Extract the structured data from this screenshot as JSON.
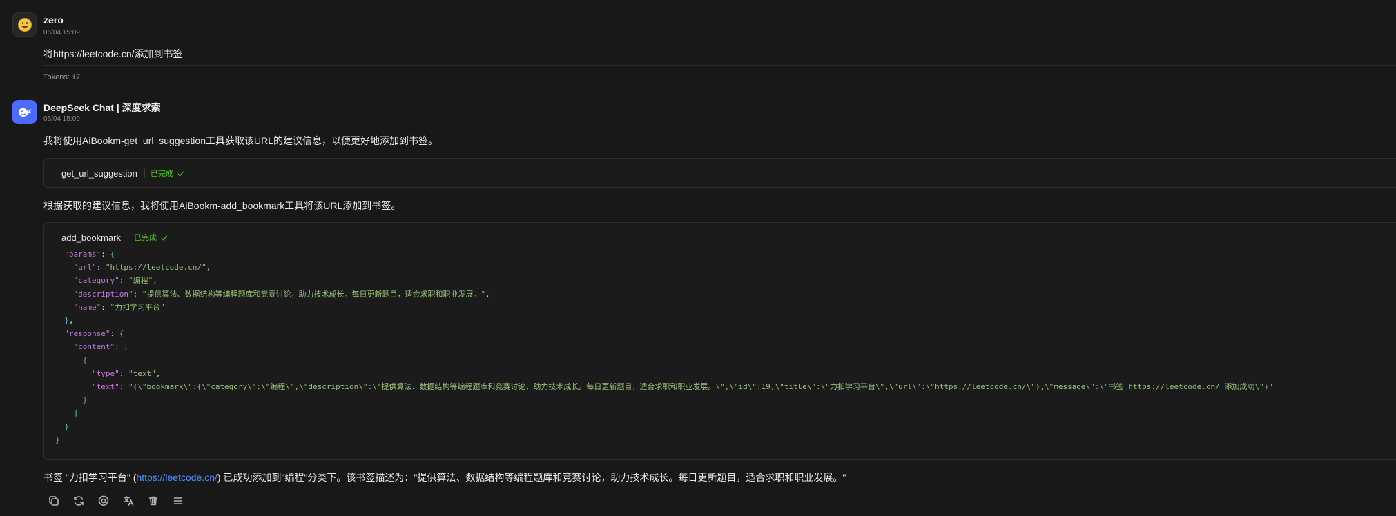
{
  "user_message": {
    "name": "zero",
    "time": "06/04 15:09",
    "text": "将https://leetcode.cn/添加到书签",
    "tokens": "Tokens: 17"
  },
  "bot_message": {
    "name": "DeepSeek Chat | 深度求索",
    "time": "06/04 15:09",
    "intro": "我将使用AiBookm-get_url_suggestion工具获取该URL的建议信息，以便更好地添加到书签。",
    "tool1": {
      "name": "get_url_suggestion",
      "status": "已完成"
    },
    "middle": "根据获取的建议信息，我将使用AiBookm-add_bookmark工具将该URL添加到书签。",
    "tool2": {
      "name": "add_bookmark",
      "status": "已完成",
      "url": "https://leetcode.cn/",
      "category": "编程",
      "description": "提供算法、数据结构等编程题库和竞赛讨论，助力技术成长。每日更新题目，适合求职和职业发展。",
      "bookmark_name": "力扣学习平台",
      "content_type": "text",
      "response_text": "{\\\"bookmark\\\":{\\\"category\\\":\\\"编程\\\",\\\"description\\\":\\\"提供算法、数据结构等编程题库和竞赛讨论，助力技术成长。每日更新题目，适合求职和职业发展。\\\",\\\"id\\\":19,\\\"title\\\":\\\"力扣学习平台\\\",\\\"url\\\":\\\"https://leetcode.cn/\\\"},\\\"message\\\":\\\"书签 https://leetcode.cn/ 添加成功\\\"}"
    },
    "final": {
      "before": "书签 \"力扣学习平台\" (",
      "link": "https://leetcode.cn/",
      "after": ") 已成功添加到\"编程\"分类下。该书签描述为：\"提供算法、数据结构等编程题库和竞赛讨论，助力技术成长。每日更新题目，适合求职和职业发展。\""
    }
  },
  "action_icons": [
    "copy-icon",
    "refresh-icon",
    "mention-icon",
    "translate-icon",
    "trash-icon",
    "menu-icon"
  ],
  "colors": {
    "accent": "#4d6bfe",
    "success": "#52c41a",
    "link": "#4d8dff",
    "background": "#181818"
  }
}
